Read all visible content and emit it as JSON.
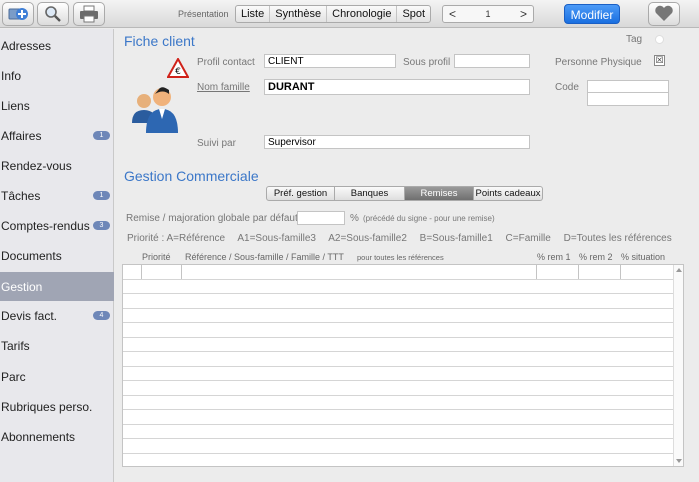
{
  "toolbar": {
    "add_icon": "add-plus-icon",
    "search_icon": "magnifier-icon",
    "print_icon": "printer-icon",
    "presentation_label": "Présentation",
    "views": [
      "Liste",
      "Synthèse",
      "Chronologie",
      "Spot"
    ],
    "pager": {
      "prev": "<",
      "page": "1",
      "next": ">"
    },
    "modify_label": "Modifier",
    "favorite_icon": "heart-icon"
  },
  "sidebar": {
    "items": [
      {
        "label": "Adresses",
        "badge": ""
      },
      {
        "label": "Info",
        "badge": ""
      },
      {
        "label": "Liens",
        "badge": ""
      },
      {
        "label": "Affaires",
        "badge": "1"
      },
      {
        "label": "Rendez-vous",
        "badge": ""
      },
      {
        "label": "Tâches",
        "badge": "1"
      },
      {
        "label": "Comptes-rendus",
        "badge": "3"
      },
      {
        "label": "Documents",
        "badge": ""
      },
      {
        "label": "Gestion",
        "badge": "",
        "active": true
      },
      {
        "label": "Devis fact.",
        "badge": "4"
      },
      {
        "label": "Tarifs",
        "badge": ""
      },
      {
        "label": "Parc",
        "badge": ""
      },
      {
        "label": "Rubriques perso.",
        "badge": ""
      },
      {
        "label": "Abonnements",
        "badge": ""
      }
    ]
  },
  "fiche": {
    "title": "Fiche  client",
    "tag_label": "Tag",
    "profil_contact_label": "Profil contact",
    "profil_contact_value": "CLIENT",
    "sous_profil_label": "Sous profil",
    "sous_profil_value": "",
    "personne_physique_label": "Personne Physique",
    "personne_physique_checked": "☒",
    "nom_famille_label": "Nom famille",
    "nom_famille_value": "DURANT",
    "code_label": "Code",
    "suivi_par_label": "Suivi par",
    "suivi_par_value": "Supervisor"
  },
  "gestion": {
    "title": "Gestion Commerciale",
    "tabs": [
      {
        "label": "Préf. gestion",
        "active": false
      },
      {
        "label": "Banques",
        "active": false
      },
      {
        "label": "Remises",
        "active": true
      },
      {
        "label": "Points cadeaux",
        "active": false
      }
    ],
    "remise_label": "Remise / majoration globale par défaut",
    "remise_value": "",
    "percent": "%",
    "remise_hint": "(précédé du signe - pour une remise)",
    "legend": [
      "Priorité :  A=Référence",
      "A1=Sous-famille3",
      "A2=Sous-famille2",
      "B=Sous-famille1",
      "C=Famille",
      "D=Toutes les références"
    ],
    "columns": {
      "priorite": "Priorité",
      "reference": "Référence / Sous-famille / Famille / TTT",
      "reference_hint": "pour toutes les références",
      "rem1": "% rem 1",
      "rem2": "% rem 2",
      "situation": "% situation"
    },
    "row_count": 13
  }
}
